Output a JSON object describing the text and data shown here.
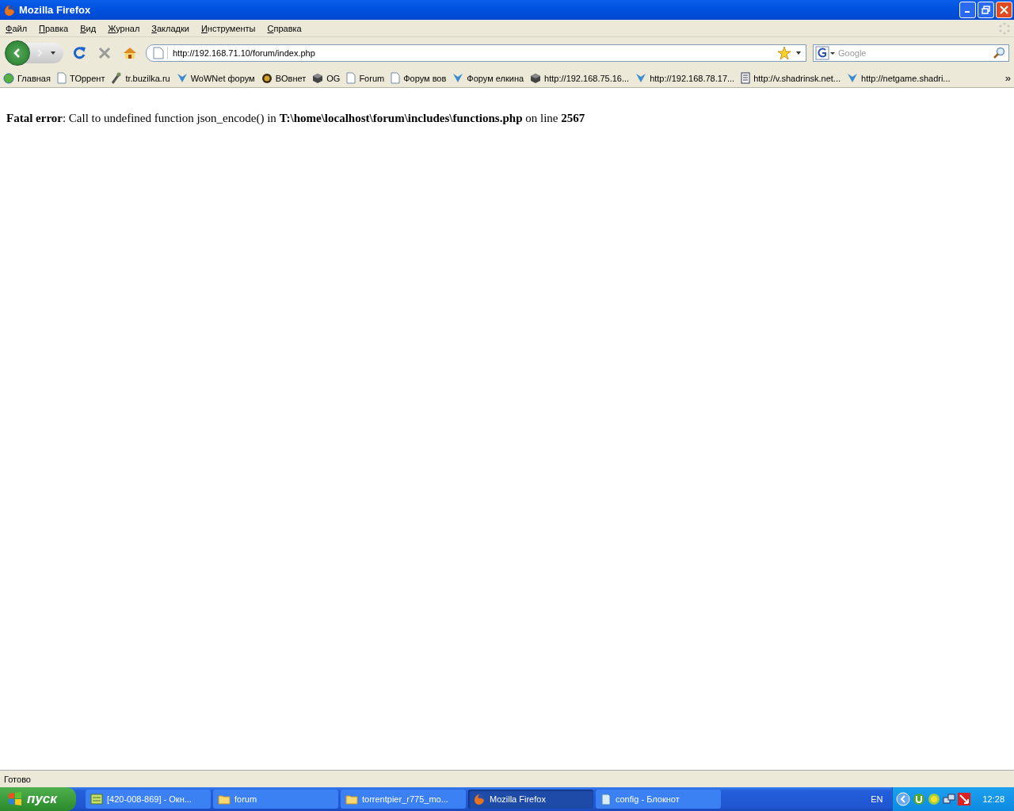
{
  "window": {
    "title": "Mozilla Firefox"
  },
  "menu": [
    "Файл",
    "Правка",
    "Вид",
    "Журнал",
    "Закладки",
    "Инструменты",
    "Справка"
  ],
  "address": {
    "value": "http://192.168.71.10/forum/index.php"
  },
  "search": {
    "placeholder": "Google"
  },
  "bookmarks": [
    {
      "label": "Главная",
      "kind": "globe"
    },
    {
      "label": "TOррент",
      "kind": "page"
    },
    {
      "label": "tr.buzilka.ru",
      "kind": "tool"
    },
    {
      "label": "WoWNet форум",
      "kind": "v"
    },
    {
      "label": "BOвнет",
      "kind": "wow"
    },
    {
      "label": "OG",
      "kind": "cube"
    },
    {
      "label": "Forum",
      "kind": "page"
    },
    {
      "label": "Форум вов",
      "kind": "page"
    },
    {
      "label": "Форум елкина",
      "kind": "v"
    },
    {
      "label": "http://192.168.75.16...",
      "kind": "cube"
    },
    {
      "label": "http://192.168.78.17...",
      "kind": "v"
    },
    {
      "label": "http://v.shadrinsk.net...",
      "kind": "doc"
    },
    {
      "label": "http://netgame.shadri...",
      "kind": "v"
    }
  ],
  "bookmarks_more": "»",
  "content": {
    "error": "**Fatal error**: Call to undefined function json_encode() in **T:\\home\\localhost\\forum\\includes\\functions.php** on line **2567**"
  },
  "status_bar": "Готово",
  "taskbar": {
    "start": "пуск",
    "items": [
      {
        "label": "[420-008-869] - Окн...",
        "kind": "app",
        "selected": false
      },
      {
        "label": "forum",
        "kind": "folder",
        "selected": false
      },
      {
        "label": "torrentpier_r775_mo...",
        "kind": "folder",
        "selected": false
      },
      {
        "label": "Mozilla Firefox",
        "kind": "firefox",
        "selected": true
      },
      {
        "label": "config - Блокнот",
        "kind": "notepad",
        "selected": false
      }
    ],
    "language": "EN",
    "clock": "12:28"
  }
}
